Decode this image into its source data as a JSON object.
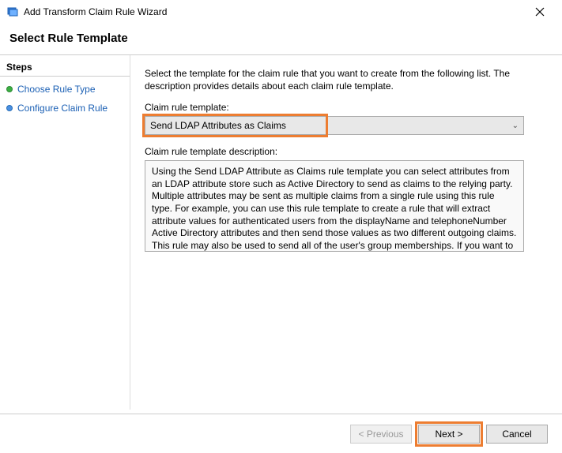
{
  "window": {
    "title": "Add Transform Claim Rule Wizard"
  },
  "page": {
    "heading": "Select Rule Template"
  },
  "sidebar": {
    "header": "Steps",
    "items": [
      {
        "label": "Choose Rule Type"
      },
      {
        "label": "Configure Claim Rule"
      }
    ]
  },
  "content": {
    "intro": "Select the template for the claim rule that you want to create from the following list. The description provides details about each claim rule template.",
    "template_label": "Claim rule template:",
    "template_value": "Send LDAP Attributes as Claims",
    "description_label": "Claim rule template description:",
    "description_text": "Using the Send LDAP Attribute as Claims rule template you can select attributes from an LDAP attribute store such as Active Directory to send as claims to the relying party. Multiple attributes may be sent as multiple claims from a single rule using this rule type. For example, you can use this rule template to create a rule that will extract attribute values for authenticated users from the displayName and telephoneNumber Active Directory attributes and then send those values as two different outgoing claims. This rule may also be used to send all of the user's group memberships. If you want to only send individual group memberships, use the Send Group Membership as a Claim rule template."
  },
  "buttons": {
    "previous": "< Previous",
    "next": "Next >",
    "cancel": "Cancel"
  }
}
